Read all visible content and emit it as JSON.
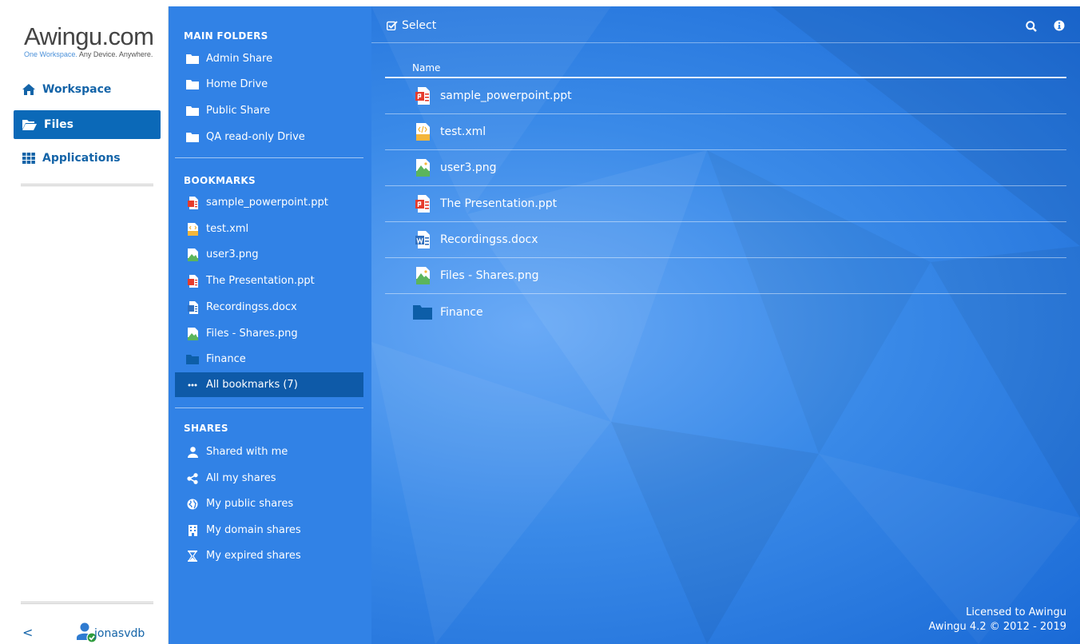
{
  "brand": {
    "logo": "Awingu.com",
    "tagline_accent": "One Workspace.",
    "tagline_rest": " Any Device. Anywhere."
  },
  "nav": {
    "workspace": "Workspace",
    "files": "Files",
    "applications": "Applications"
  },
  "user": {
    "back": "<",
    "name": "jonasvdb"
  },
  "panel": {
    "main_folders_title": "MAIN FOLDERS",
    "main_folders": [
      "Admin Share",
      "Home Drive",
      "Public Share",
      "QA read-only Drive"
    ],
    "bookmarks_title": "BOOKMARKS",
    "bookmarks": [
      "sample_powerpoint.ppt",
      "test.xml",
      "user3.png",
      "The Presentation.ppt",
      "Recordingss.docx",
      "Files - Shares.png",
      "Finance"
    ],
    "all_bookmarks": "All bookmarks (7)",
    "shares_title": "SHARES",
    "shares": [
      "Shared with me",
      "All my shares",
      "My public shares",
      "My domain shares",
      "My expired shares"
    ]
  },
  "toolbar": {
    "select": "Select"
  },
  "table": {
    "column_name": "Name",
    "rows": [
      "sample_powerpoint.ppt",
      "test.xml",
      "user3.png",
      "The Presentation.ppt",
      "Recordingss.docx",
      "Files - Shares.png",
      "Finance"
    ]
  },
  "footer": {
    "license": "Licensed to Awingu",
    "version": "Awingu 4.2 © 2012 - 2019"
  },
  "colors": {
    "accent": "#0b69b8",
    "panel": "#3182e6",
    "ppt": "#e53b2c",
    "xml": "#f4b63b",
    "png": "#5bb55c",
    "docx": "#2f6fbf",
    "folder": "#0d5ea8"
  }
}
